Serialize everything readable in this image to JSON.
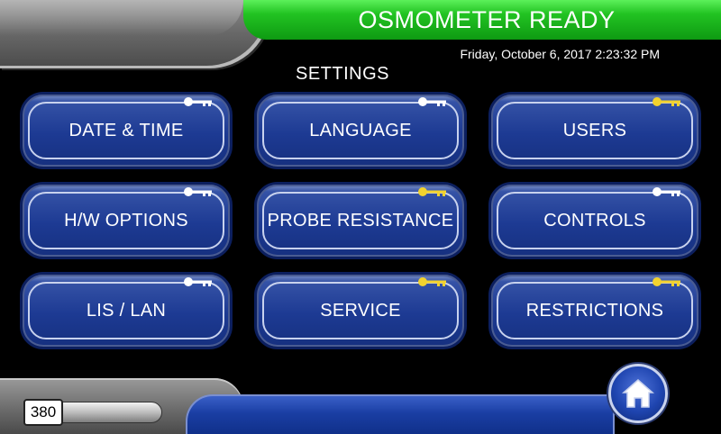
{
  "header": {
    "status": "OSMOMETER READY",
    "datetime": "Friday, October 6, 2017 2:23:32 PM",
    "title": "SETTINGS"
  },
  "buttons": [
    {
      "label": "DATE & TIME",
      "key_color": "#ffffff"
    },
    {
      "label": "LANGUAGE",
      "key_color": "#ffffff"
    },
    {
      "label": "USERS",
      "key_color": "#f2d22e"
    },
    {
      "label": "H/W OPTIONS",
      "key_color": "#ffffff"
    },
    {
      "label": "PROBE RESISTANCE",
      "key_color": "#f2d22e"
    },
    {
      "label": "CONTROLS",
      "key_color": "#ffffff"
    },
    {
      "label": "LIS / LAN",
      "key_color": "#ffffff"
    },
    {
      "label": "SERVICE",
      "key_color": "#f2d22e"
    },
    {
      "label": "RESTRICTIONS",
      "key_color": "#f2d22e"
    }
  ],
  "footer": {
    "counter": "380",
    "home_icon": "home-icon"
  },
  "colors": {
    "status_green": "#22c322",
    "button_blue": "#1d3a93"
  }
}
